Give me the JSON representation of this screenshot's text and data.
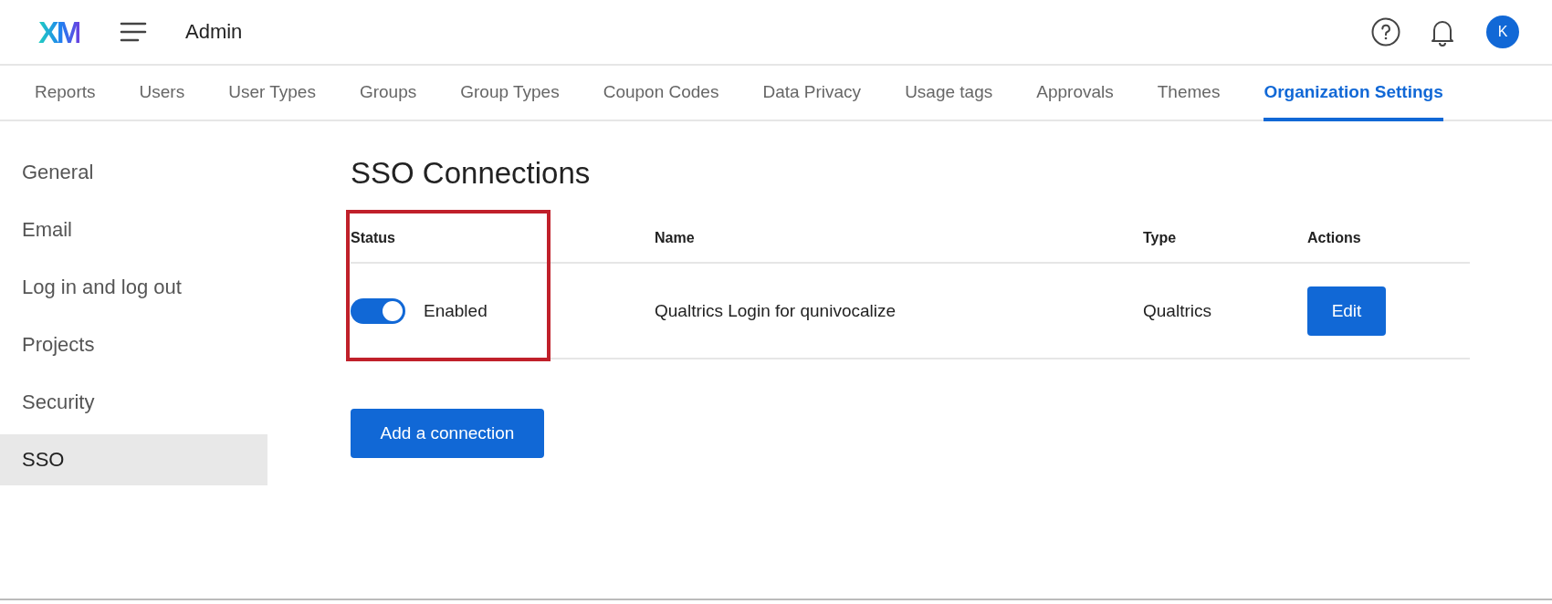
{
  "header": {
    "logo": "XM",
    "title": "Admin",
    "avatar": "K"
  },
  "tabs": [
    {
      "label": "Reports",
      "selected": false
    },
    {
      "label": "Users",
      "selected": false
    },
    {
      "label": "User Types",
      "selected": false
    },
    {
      "label": "Groups",
      "selected": false
    },
    {
      "label": "Group Types",
      "selected": false
    },
    {
      "label": "Coupon Codes",
      "selected": false
    },
    {
      "label": "Data Privacy",
      "selected": false
    },
    {
      "label": "Usage tags",
      "selected": false
    },
    {
      "label": "Approvals",
      "selected": false
    },
    {
      "label": "Themes",
      "selected": false
    },
    {
      "label": "Organization Settings",
      "selected": true
    }
  ],
  "sidebar": {
    "items": [
      {
        "label": "General",
        "selected": false
      },
      {
        "label": "Email",
        "selected": false
      },
      {
        "label": "Log in and log out",
        "selected": false
      },
      {
        "label": "Projects",
        "selected": false
      },
      {
        "label": "Security",
        "selected": false
      },
      {
        "label": "SSO",
        "selected": true
      }
    ]
  },
  "page_title": "SSO Connections",
  "table": {
    "columns": [
      "Status",
      "Name",
      "Type",
      "Actions"
    ],
    "status_highlighted": true,
    "rows": [
      {
        "on": true,
        "status": "Enabled",
        "name": "Qualtrics Login for qunivocalize",
        "type": "Qualtrics",
        "action": "Edit"
      }
    ]
  },
  "add_button": "Add a connection"
}
